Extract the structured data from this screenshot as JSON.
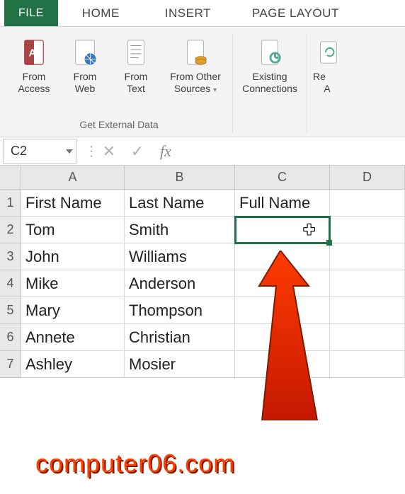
{
  "tabs": {
    "file": "FILE",
    "home": "HOME",
    "insert": "INSERT",
    "page_layout": "PAGE LAYOUT"
  },
  "ribbon": {
    "group1_label": "Get External Data",
    "from_access": {
      "l1": "From",
      "l2": "Access"
    },
    "from_web": {
      "l1": "From",
      "l2": "Web"
    },
    "from_text": {
      "l1": "From",
      "l2": "Text"
    },
    "from_other": {
      "l1": "From Other",
      "l2": "Sources",
      "arrow": "▾"
    },
    "existing_conn": {
      "l1": "Existing",
      "l2": "Connections"
    },
    "refresh": {
      "l1": "Re",
      "l2": "A"
    }
  },
  "namebox": {
    "value": "C2"
  },
  "formula_bar": {
    "value": ""
  },
  "columns": [
    "A",
    "B",
    "C",
    "D"
  ],
  "grid": {
    "r1": {
      "A": "First Name",
      "B": "Last Name",
      "C": "Full Name"
    },
    "r2": {
      "A": "Tom",
      "B": "Smith",
      "C": ""
    },
    "r3": {
      "A": "John",
      "B": "Williams",
      "C": ""
    },
    "r4": {
      "A": "Mike",
      "B": "Anderson",
      "C": ""
    },
    "r5": {
      "A": "Mary",
      "B": "Thompson",
      "C": ""
    },
    "r6": {
      "A": "Annete",
      "B": "Christian",
      "C": ""
    },
    "r7": {
      "A": "Ashley",
      "B": "Mosier",
      "C": ""
    }
  },
  "watermark": "computer06.com"
}
